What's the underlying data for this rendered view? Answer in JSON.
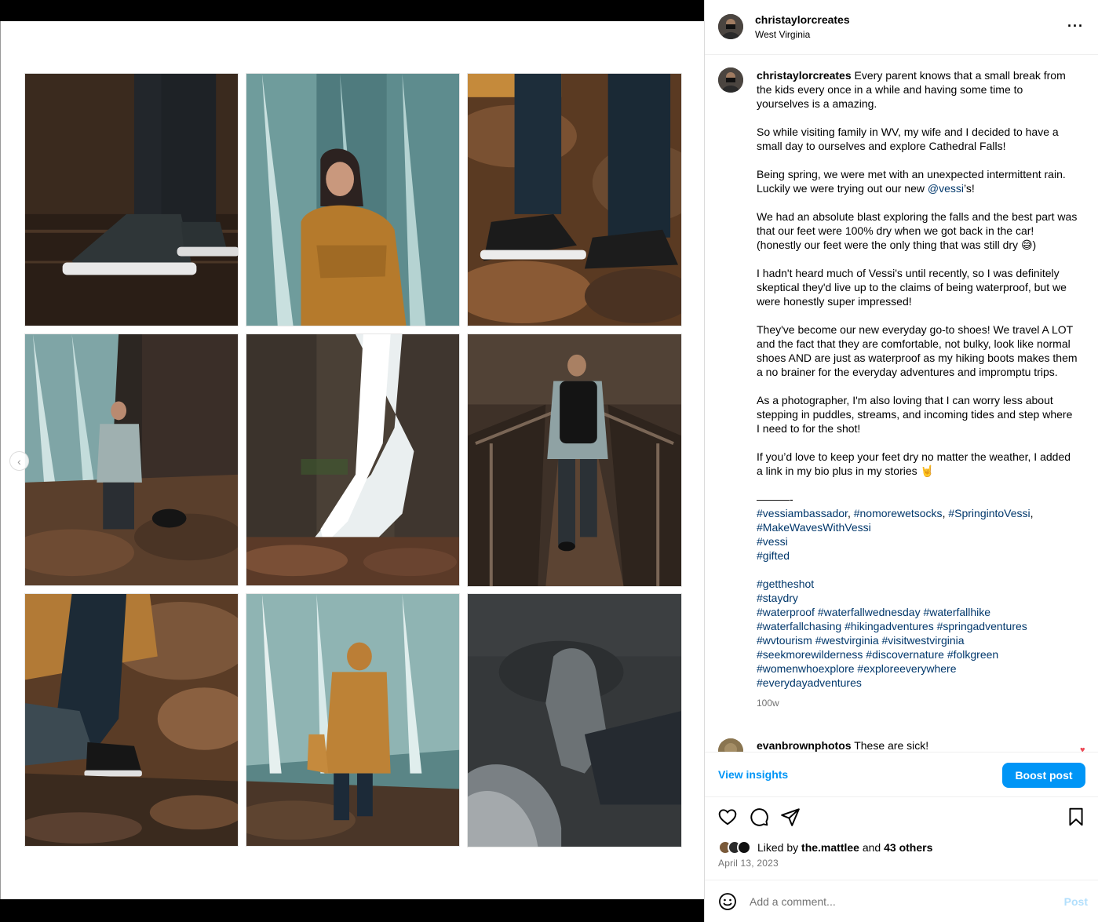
{
  "header": {
    "username": "christaylorcreates",
    "location": "West Virginia",
    "more_icon": "more-horizontal-icon"
  },
  "media": {
    "prev_icon": "chevron-left-icon",
    "prev_glyph": "‹",
    "photos": [
      {
        "desc": "shoes-on-wet-floor"
      },
      {
        "desc": "woman-at-waterfall"
      },
      {
        "desc": "shoes-on-rocks"
      },
      {
        "desc": "man-by-waterfall"
      },
      {
        "desc": "long-exposure-waterfall"
      },
      {
        "desc": "man-on-bridge"
      },
      {
        "desc": "walking-on-rocks"
      },
      {
        "desc": "woman-photographing-falls"
      },
      {
        "desc": "shoe-pov"
      }
    ]
  },
  "caption": {
    "username": "christaylorcreates",
    "p1": "Every parent knows that a small break from the kids every once in a while and having some time to yourselves is a amazing.",
    "p2": "So while visiting family in WV, my wife and I decided to have a small day to ourselves and explore Cathedral Falls!",
    "p3_before": "Being spring, we were met with an unexpected intermittent rain. Luckily we were trying out our new ",
    "p3_mention": "@vessi",
    "p3_after": "’s!",
    "p4": "We had an absolute blast exploring the falls and the best part was that our feet were 100% dry when we got back in the car! (honestly our feet were the only thing that was still dry 😅)",
    "p5": "I hadn't heard much of Vessi's until recently, so I was definitely skeptical they'd live up to the claims of being waterproof, but we were honestly super impressed!",
    "p6": "They've become our new everyday go-to shoes! We travel A LOT and the fact that they are comfortable, not bulky, look like normal shoes AND are just as waterproof as my hiking boots makes them a no brainer for the everyday adventures and impromptu trips.",
    "p7": "As a photographer, I'm also loving that I can worry less about stepping in puddles, streams, and incoming tides and step where I need to for the shot!",
    "p8": "If you’d love to keep your feet dry no matter the weather, I added a link in my bio plus in my stories 🤘",
    "divider": "———-",
    "tags1": [
      "#vessiambassador",
      "#nomorewetsocks",
      "#SpringintoVessi"
    ],
    "tags1_sep": ", ",
    "tags1_end": ",",
    "tags1b": "#MakeWavesWithVessi",
    "tag_vessi": "#vessi",
    "tag_gifted": "#gifted",
    "tags2": [
      [
        "#gettheshot"
      ],
      [
        "#staydry"
      ],
      [
        "#waterproof",
        "#waterfallwednesday",
        "#waterfallhike"
      ],
      [
        "#waterfallchasing",
        "#hikingadventures",
        "#springadventures"
      ],
      [
        "#wvtourism",
        "#westvirginia",
        "#visitwestvirginia"
      ],
      [
        "#seekmorewilderness",
        "#discovernature",
        "#folkgreen"
      ],
      [
        "#womenwhoexplore",
        "#exploreeverywhere"
      ],
      [
        "#everydayadventures"
      ]
    ],
    "time": "100w"
  },
  "comment": {
    "username": "evanbrownphotos",
    "text": "These are sick!",
    "like_icon": "heart-small-icon",
    "like_glyph": "♥"
  },
  "actions": {
    "view_insights": "View insights",
    "boost_post": "Boost post"
  },
  "likes": {
    "prefix": "Liked by ",
    "user": "the.mattlee",
    "middle": " and ",
    "others": "43 others"
  },
  "date": "April 13, 2023",
  "comment_box": {
    "placeholder": "Add a comment...",
    "post_label": "Post"
  },
  "colors": {
    "link": "#00376b",
    "accent": "#0095f6",
    "post_disabled": "#b2dffc"
  }
}
